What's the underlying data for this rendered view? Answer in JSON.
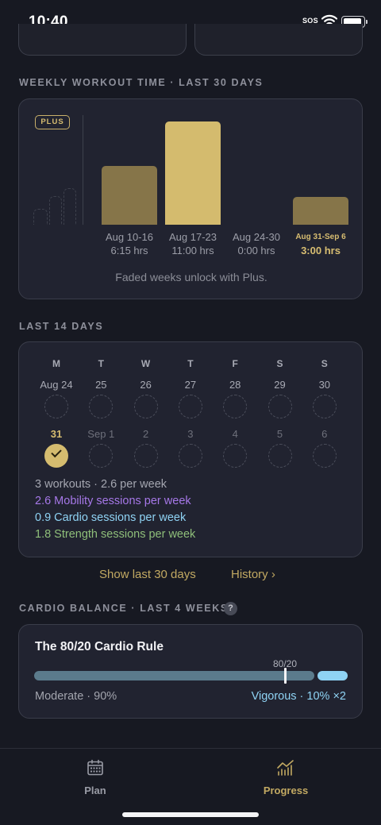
{
  "status_bar": {
    "time": "10:40",
    "sos": "SOS"
  },
  "weekly": {
    "section_title": "WEEKLY WORKOUT TIME · LAST 30 DAYS",
    "plus_badge": "PLUS",
    "weeks": [
      {
        "date": "Aug 10-16",
        "value": "6:15 hrs",
        "hours": 6.25,
        "color": "#867549",
        "current": false
      },
      {
        "date": "Aug 17-23",
        "value": "11:00 hrs",
        "hours": 11,
        "color": "#d4bb6e",
        "current": false
      },
      {
        "date": "Aug 24-30",
        "value": "0:00 hrs",
        "hours": 0,
        "color": "#867549",
        "current": false
      },
      {
        "date": "Aug 31-Sep 6",
        "value": "3:00 hrs",
        "hours": 3,
        "color": "#867549",
        "current": true
      }
    ],
    "note": "Faded weeks unlock with Plus."
  },
  "last14": {
    "section_title": "LAST 14 DAYS",
    "weekdays": [
      "M",
      "T",
      "W",
      "T",
      "F",
      "S",
      "S"
    ],
    "week1": [
      "Aug 24",
      "25",
      "26",
      "27",
      "28",
      "29",
      "30"
    ],
    "week2": [
      "31",
      "Sep 1",
      "2",
      "3",
      "4",
      "5",
      "6"
    ],
    "summary": "3 workouts · 2.6 per week",
    "mobility": "2.6 Mobility sessions per week",
    "cardio": "0.9 Cardio sessions per week",
    "strength": "1.8 Strength sessions per week",
    "colors": {
      "mobility": "#a678e8",
      "cardio": "#8fd3f4",
      "strength": "#8fbf7a"
    }
  },
  "links": {
    "show_30": "Show last 30 days",
    "history": "History ›"
  },
  "cardio_balance": {
    "section_title": "CARDIO BALANCE · LAST 4 WEEKS",
    "help": "?",
    "card_title": "The 80/20 Cardio Rule",
    "marker_label": "80/20",
    "moderate": "Moderate · 90%",
    "vigorous": "Vigorous · 10% ×2"
  },
  "tabs": [
    {
      "label": "Plan",
      "icon": "calendar-icon",
      "active": false
    },
    {
      "label": "Progress",
      "icon": "chart-icon",
      "active": true
    }
  ]
}
